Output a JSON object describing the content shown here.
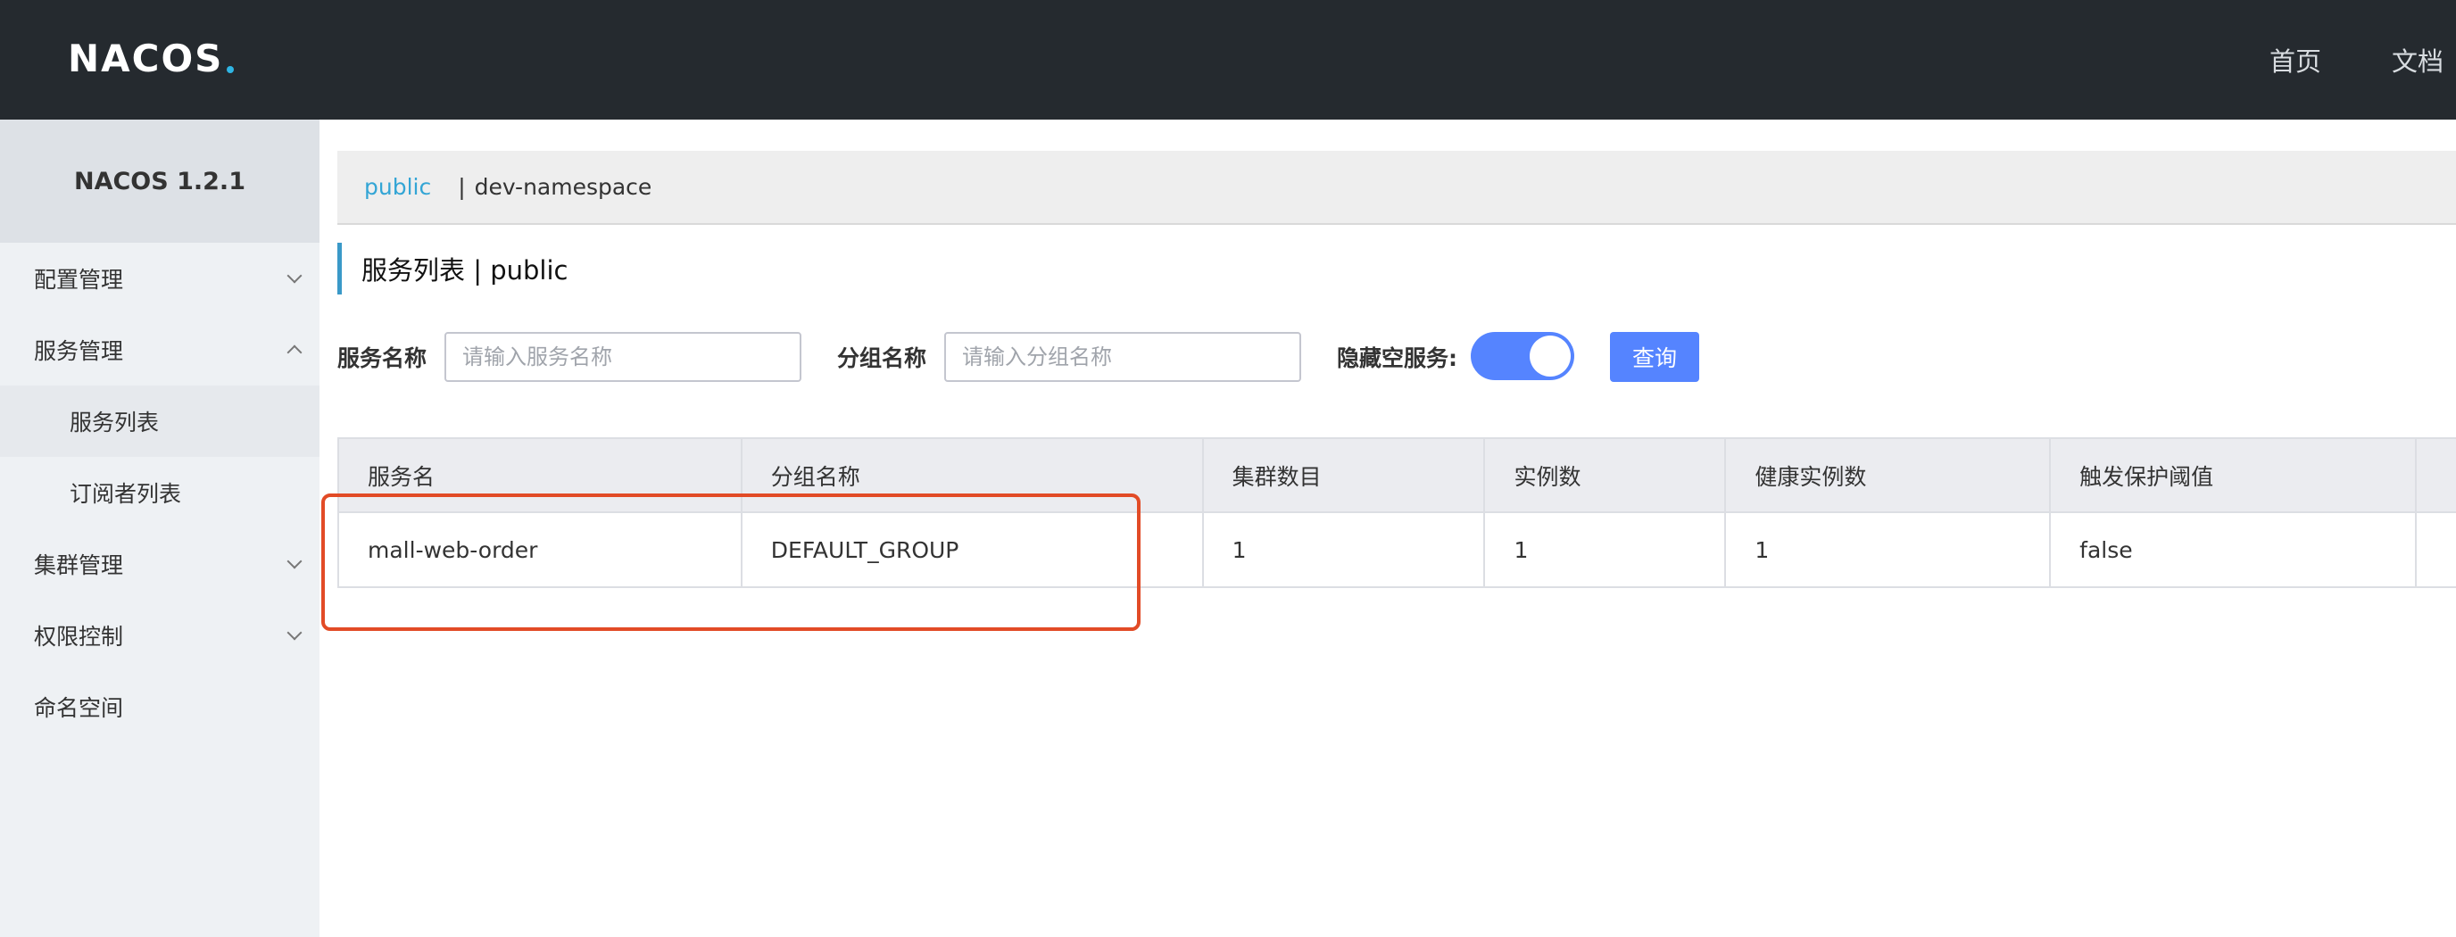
{
  "header": {
    "logo": "NACOS",
    "nav": [
      "首页",
      "文档"
    ]
  },
  "sidebar": {
    "title": "NACOS 1.2.1",
    "items": [
      {
        "label": "配置管理"
      },
      {
        "label": "服务管理"
      },
      {
        "label": "服务列表"
      },
      {
        "label": "订阅者列表"
      },
      {
        "label": "集群管理"
      },
      {
        "label": "权限控制"
      },
      {
        "label": "命名空间"
      }
    ]
  },
  "namespaces": {
    "active": "public",
    "separator": "|",
    "other": "dev-namespace"
  },
  "page": {
    "title": "服务列表 | public"
  },
  "form": {
    "service_name_label": "服务名称",
    "service_name_placeholder": "请输入服务名称",
    "group_name_label": "分组名称",
    "group_name_placeholder": "请输入分组名称",
    "hide_empty_label": "隐藏空服务:",
    "query_label": "查询"
  },
  "table": {
    "headers": [
      "服务名",
      "分组名称",
      "集群数目",
      "实例数",
      "健康实例数",
      "触发保护阈值"
    ],
    "rows": [
      [
        "mall-web-order",
        "DEFAULT_GROUP",
        "1",
        "1",
        "1",
        "false"
      ]
    ]
  },
  "colors": {
    "topbar": "#252a2f",
    "accent": "#5584ff",
    "namespace_active": "#33a5d5",
    "highlight_box": "#e24b26"
  }
}
